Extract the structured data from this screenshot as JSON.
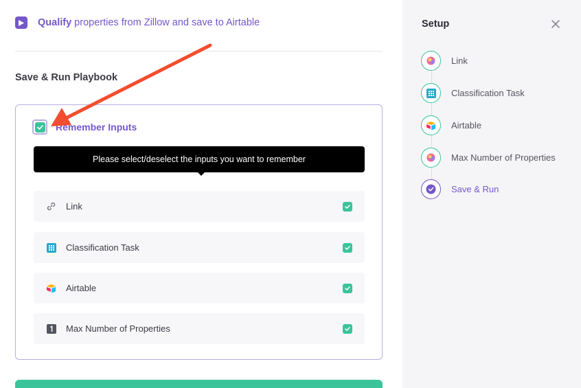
{
  "playbook": {
    "title_bold": "Qualify",
    "title_rest": " properties from Zillow and save to Airtable"
  },
  "save_run": {
    "title": "Save & Run Playbook",
    "remember_label": "Remember Inputs",
    "remember_checked": true,
    "tooltip": "Please select/deselect the inputs you want to remember",
    "inputs": [
      {
        "label": "Link",
        "icon": "link-icon",
        "checked": true
      },
      {
        "label": "Classification Task",
        "icon": "grid-icon",
        "checked": true
      },
      {
        "label": "Airtable",
        "icon": "airtable-icon",
        "checked": true
      },
      {
        "label": "Max Number of Properties",
        "icon": "number-one-icon",
        "checked": true
      }
    ]
  },
  "setup": {
    "title": "Setup",
    "steps": [
      {
        "label": "Link",
        "icon": "link-icon",
        "status": "complete"
      },
      {
        "label": "Classification Task",
        "icon": "grid-icon",
        "status": "complete"
      },
      {
        "label": "Airtable",
        "icon": "airtable-icon",
        "status": "complete"
      },
      {
        "label": "Max Number of Properties",
        "icon": "link-icon",
        "status": "complete"
      },
      {
        "label": "Save & Run",
        "icon": "check-circle-icon",
        "status": "active"
      }
    ]
  },
  "colors": {
    "accent": "#7557c9",
    "success": "#3bc49a",
    "annotation_arrow": "#f24d2e"
  }
}
